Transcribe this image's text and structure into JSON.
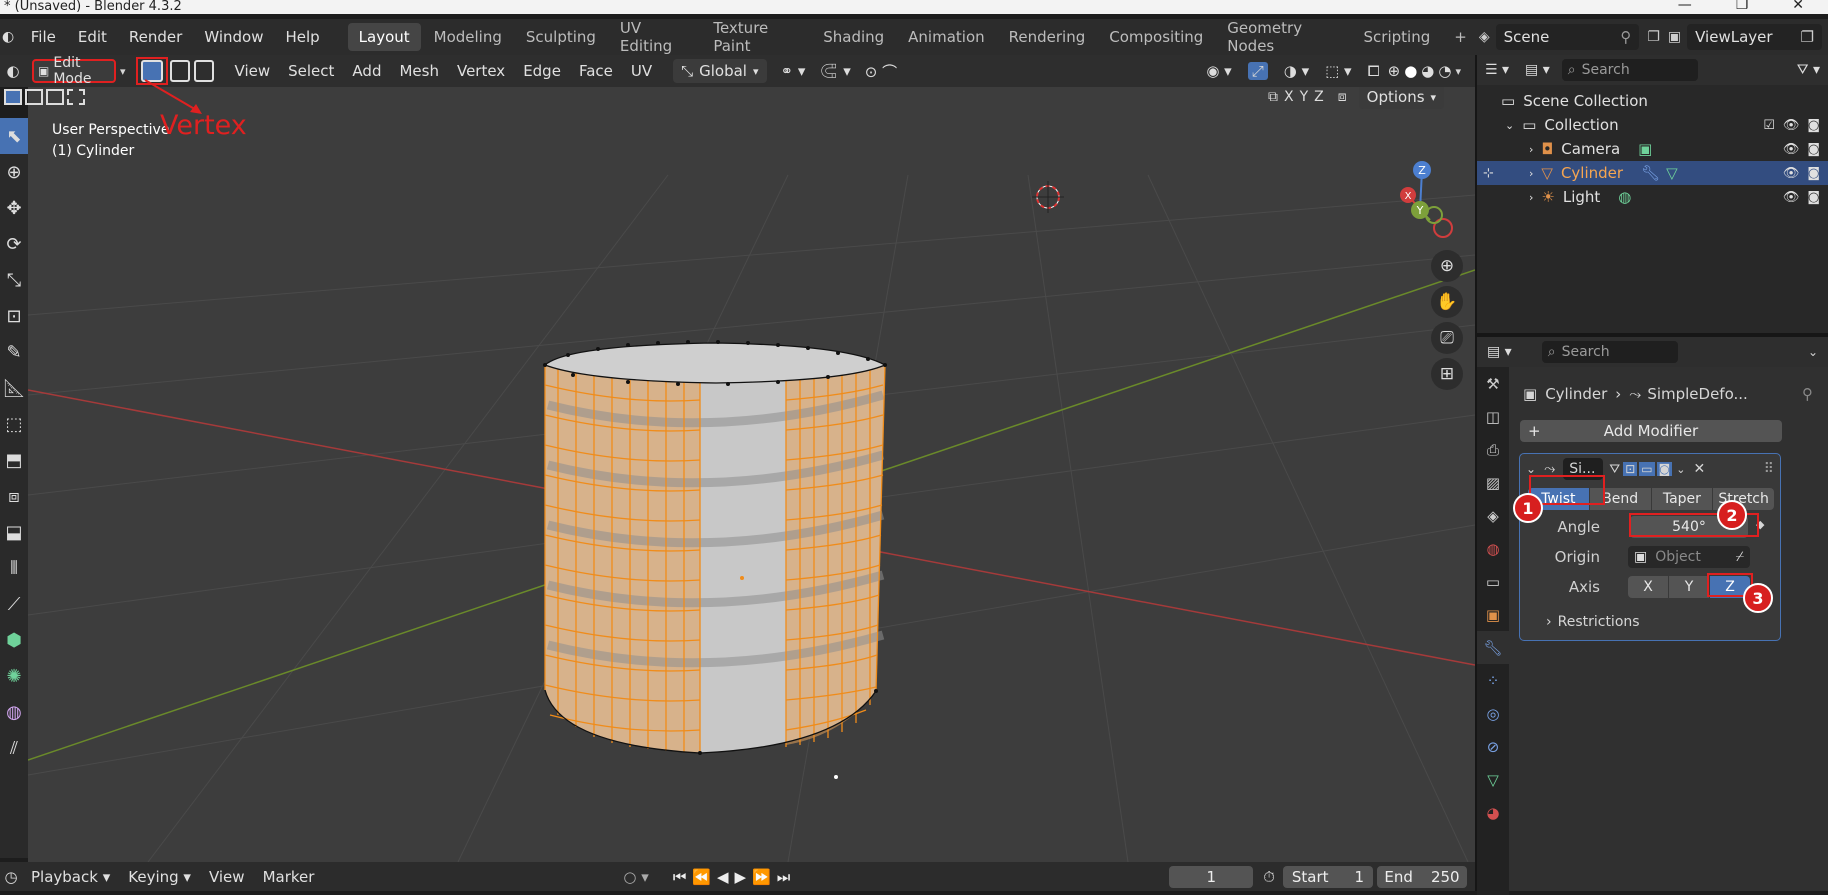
{
  "window": {
    "title": "* (Unsaved) - Blender 4.3.2",
    "controls": [
      "—",
      "❐",
      "✕"
    ]
  },
  "menubar": {
    "menus": [
      "File",
      "Edit",
      "Render",
      "Window",
      "Help"
    ],
    "workspaces": [
      "Layout",
      "Modeling",
      "Sculpting",
      "UV Editing",
      "Texture Paint",
      "Shading",
      "Animation",
      "Rendering",
      "Compositing",
      "Geometry Nodes",
      "Scripting"
    ],
    "active_workspace": "Layout",
    "add_tab": "+",
    "scene": "Scene",
    "view_layer": "ViewLayer"
  },
  "viewport_header": {
    "mode": "Edit Mode",
    "menus": [
      "View",
      "Select",
      "Add",
      "Mesh",
      "Vertex",
      "Edge",
      "Face",
      "UV"
    ],
    "transform_orientation": "Global",
    "axes": [
      "X",
      "Y",
      "Z"
    ],
    "options": "Options"
  },
  "viewport": {
    "perspective": "User Perspective",
    "object": "(1) Cylinder",
    "annotation": "Vertex",
    "gizmo": {
      "x": "X",
      "y": "Y",
      "z": "Z"
    }
  },
  "timeline": {
    "menus": [
      "Playback",
      "Keying",
      "View",
      "Marker"
    ],
    "current_frame": "1",
    "start_label": "Start",
    "start": "1",
    "end_label": "End",
    "end": "250"
  },
  "outliner": {
    "search_placeholder": "Search",
    "items": [
      {
        "label": "Scene Collection",
        "icon": "scene-collection-icon"
      },
      {
        "label": "Collection",
        "icon": "collection-icon"
      },
      {
        "label": "Camera",
        "icon": "camera-icon"
      },
      {
        "label": "Cylinder",
        "icon": "mesh-icon",
        "selected": true
      },
      {
        "label": "Light",
        "icon": "light-icon"
      }
    ]
  },
  "properties": {
    "search_placeholder": "Search",
    "breadcrumb_object": "Cylinder",
    "breadcrumb_modifier": "SimpleDefo...",
    "add_modifier": "Add Modifier",
    "modifier_name": "Si...",
    "deform_modes": [
      "Twist",
      "Bend",
      "Taper",
      "Stretch"
    ],
    "active_mode": "Twist",
    "angle_label": "Angle",
    "angle_value": "540°",
    "origin_label": "Origin",
    "origin_placeholder": "Object",
    "axis_label": "Axis",
    "axes": [
      "X",
      "Y",
      "Z"
    ],
    "active_axis": "Z",
    "restrictions": "Restrictions"
  },
  "annotations": {
    "badges": [
      "1",
      "2",
      "3"
    ],
    "color": "#e02020"
  },
  "colors": {
    "accent": "#4772b3",
    "selection": "#f08c1a",
    "viewport_bg": "#3d3d3d"
  }
}
